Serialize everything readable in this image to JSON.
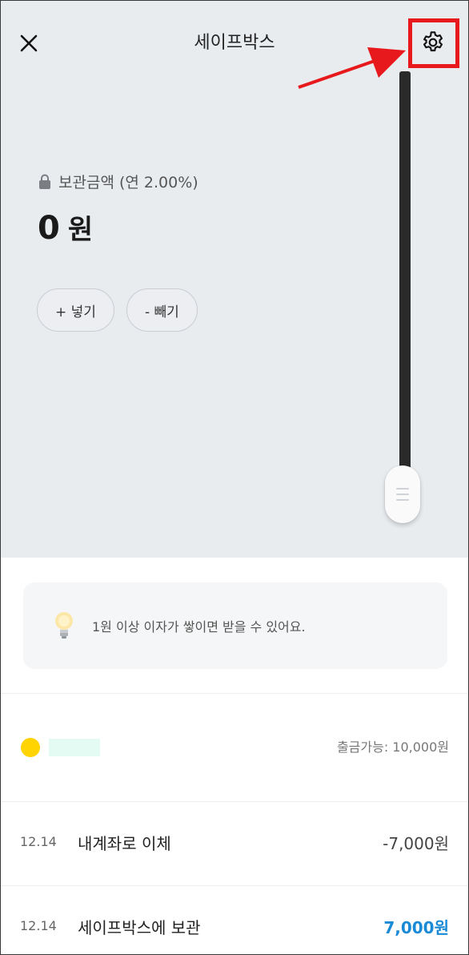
{
  "header": {
    "title": "세이프박스",
    "close_icon": "close-icon",
    "settings_icon": "gear-icon"
  },
  "annotation": {
    "highlight_color": "#e8191c"
  },
  "balance": {
    "rate_label": "보관금액 (연 2.00%)",
    "amount": "0",
    "unit": "원"
  },
  "actions": {
    "deposit_label": "+ 넣기",
    "withdraw_label": "- 빼기"
  },
  "slider": {
    "level": 0
  },
  "tip": {
    "icon": "lightbulb-icon",
    "text": "1원 이상 이자가 쌓이면 받을 수 있어요."
  },
  "account": {
    "dot_color": "#ffd400",
    "available": "출금가능: 10,000원"
  },
  "transactions": [
    {
      "date": "12.14",
      "desc": "내계좌로 이체",
      "amount": "-7,000원"
    },
    {
      "date": "12.14",
      "desc": "세이프박스에 보관",
      "amount": "7,000원"
    }
  ],
  "colors": {
    "background": "#e9ecef",
    "positive_amount": "#1a8ad6"
  }
}
